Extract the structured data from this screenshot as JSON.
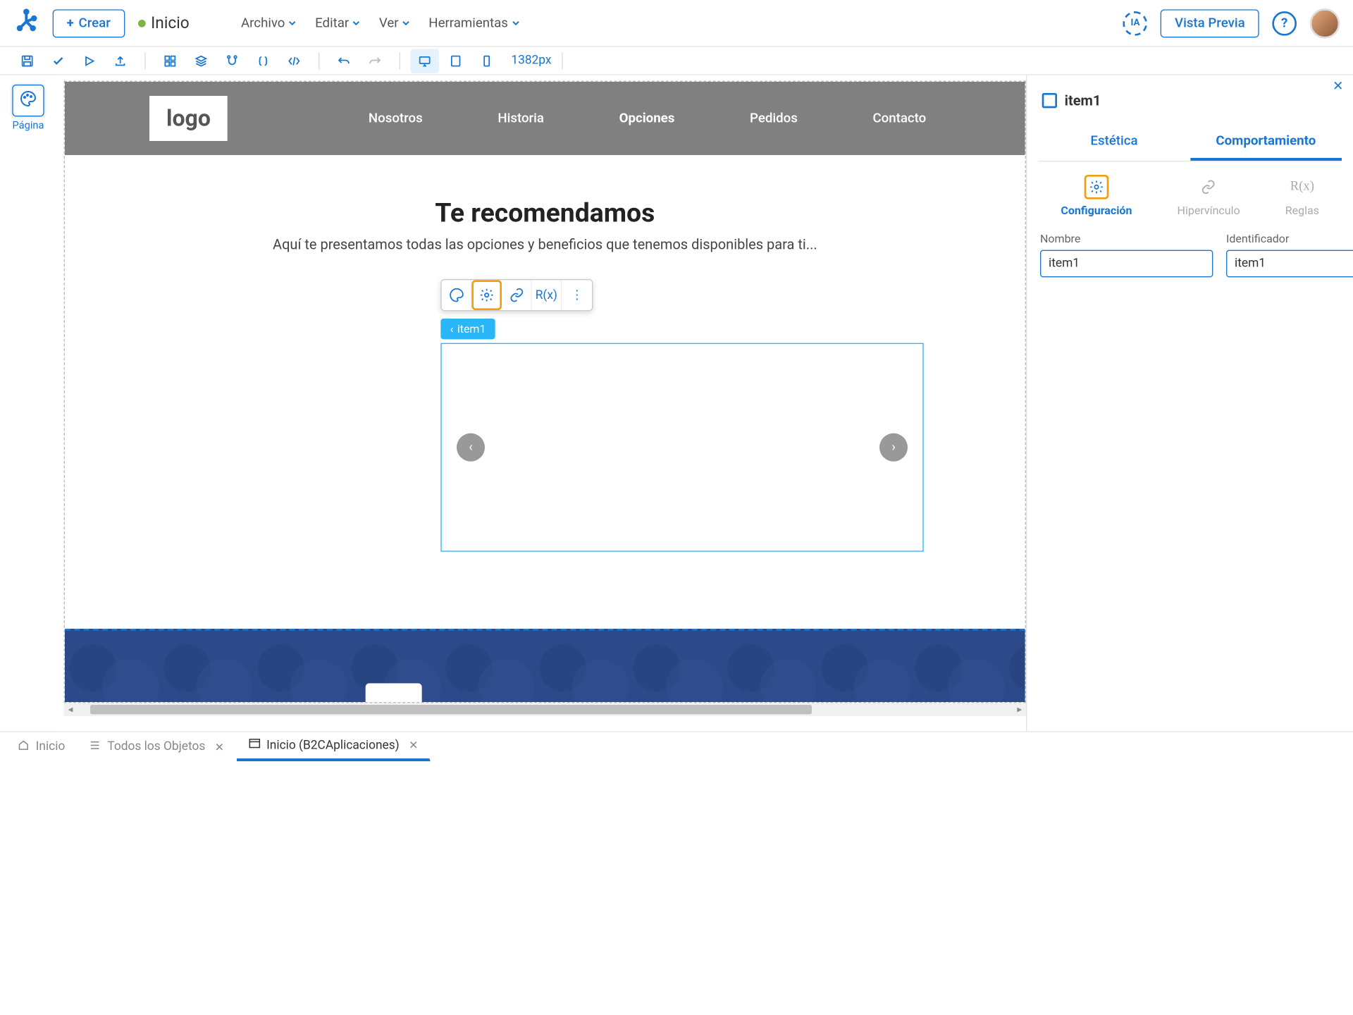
{
  "top": {
    "create": "Crear",
    "doc_title": "Inicio",
    "menus": [
      "Archivo",
      "Editar",
      "Ver",
      "Herramientas"
    ],
    "preview": "Vista Previa",
    "ia": "IA"
  },
  "toolbar": {
    "width_px": "1382px"
  },
  "left": {
    "page_label": "Página"
  },
  "site": {
    "logo": "logo",
    "nav": [
      "Nosotros",
      "Historia",
      "Opciones",
      "Pedidos",
      "Contacto"
    ],
    "nav_active_index": 2,
    "recommend_title": "Te recomendamos",
    "recommend_sub": "Aquí te presentamos todas las opciones y beneficios que tenemos disponibles para ti..."
  },
  "selection": {
    "label": "item1",
    "rx_label": "R(x)"
  },
  "panel": {
    "title": "item1",
    "tabs": [
      "Estética",
      "Comportamiento"
    ],
    "active_tab": 1,
    "sub_tabs": [
      "Configuración",
      "Hipervínculo",
      "Reglas"
    ],
    "active_sub": 0,
    "name_label": "Nombre",
    "id_label": "Identificador",
    "name_value": "item1",
    "id_value": "item1",
    "rx_label": "R(x)"
  },
  "bottom": {
    "tabs": [
      {
        "label": "Inicio",
        "closable": false,
        "icon": "home"
      },
      {
        "label": "Todos los Objetos",
        "closable": true,
        "icon": "list"
      },
      {
        "label": "Inicio (B2CAplicaciones)",
        "closable": true,
        "icon": "window",
        "active": true
      }
    ]
  }
}
